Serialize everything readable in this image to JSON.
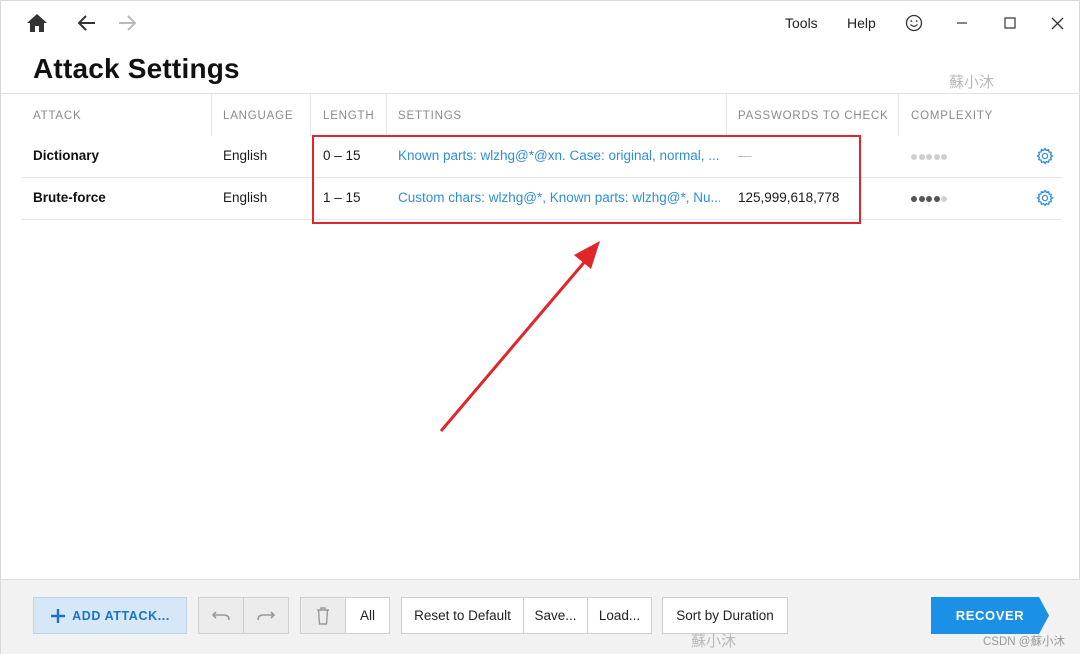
{
  "titlebar": {
    "menu": [
      "Tools",
      "Help"
    ]
  },
  "page": {
    "title": "Attack Settings",
    "watermark": "蘇小沐"
  },
  "table": {
    "headers": [
      "ATTACK",
      "LANGUAGE",
      "LENGTH",
      "SETTINGS",
      "PASSWORDS TO CHECK",
      "COMPLEXITY"
    ],
    "rows": [
      {
        "attack": "Dictionary",
        "language": "English",
        "length": "0 – 15",
        "settings": "Known parts: wlzhg@*@xn. Case: original, normal, ...",
        "passwords": "—",
        "complexity": 0
      },
      {
        "attack": "Brute-force",
        "language": "English",
        "length": "1 – 15",
        "settings": "Custom chars: wlzhg@*, Known parts: wlzhg@*, Nu...",
        "passwords": "125,999,618,778",
        "complexity": 4
      }
    ],
    "complexity_max": 5
  },
  "footer": {
    "add_attack": "ADD ATTACK...",
    "all": "All",
    "reset": "Reset to Default",
    "save": "Save...",
    "load": "Load...",
    "sort": "Sort by Duration",
    "recover": "RECOVER",
    "watermark": "蘇小沐",
    "credit": "CSDN @蘇小沐"
  },
  "colors": {
    "accent": "#1a90e6",
    "link": "#2f8fd6",
    "annotation": "#e0262b"
  }
}
